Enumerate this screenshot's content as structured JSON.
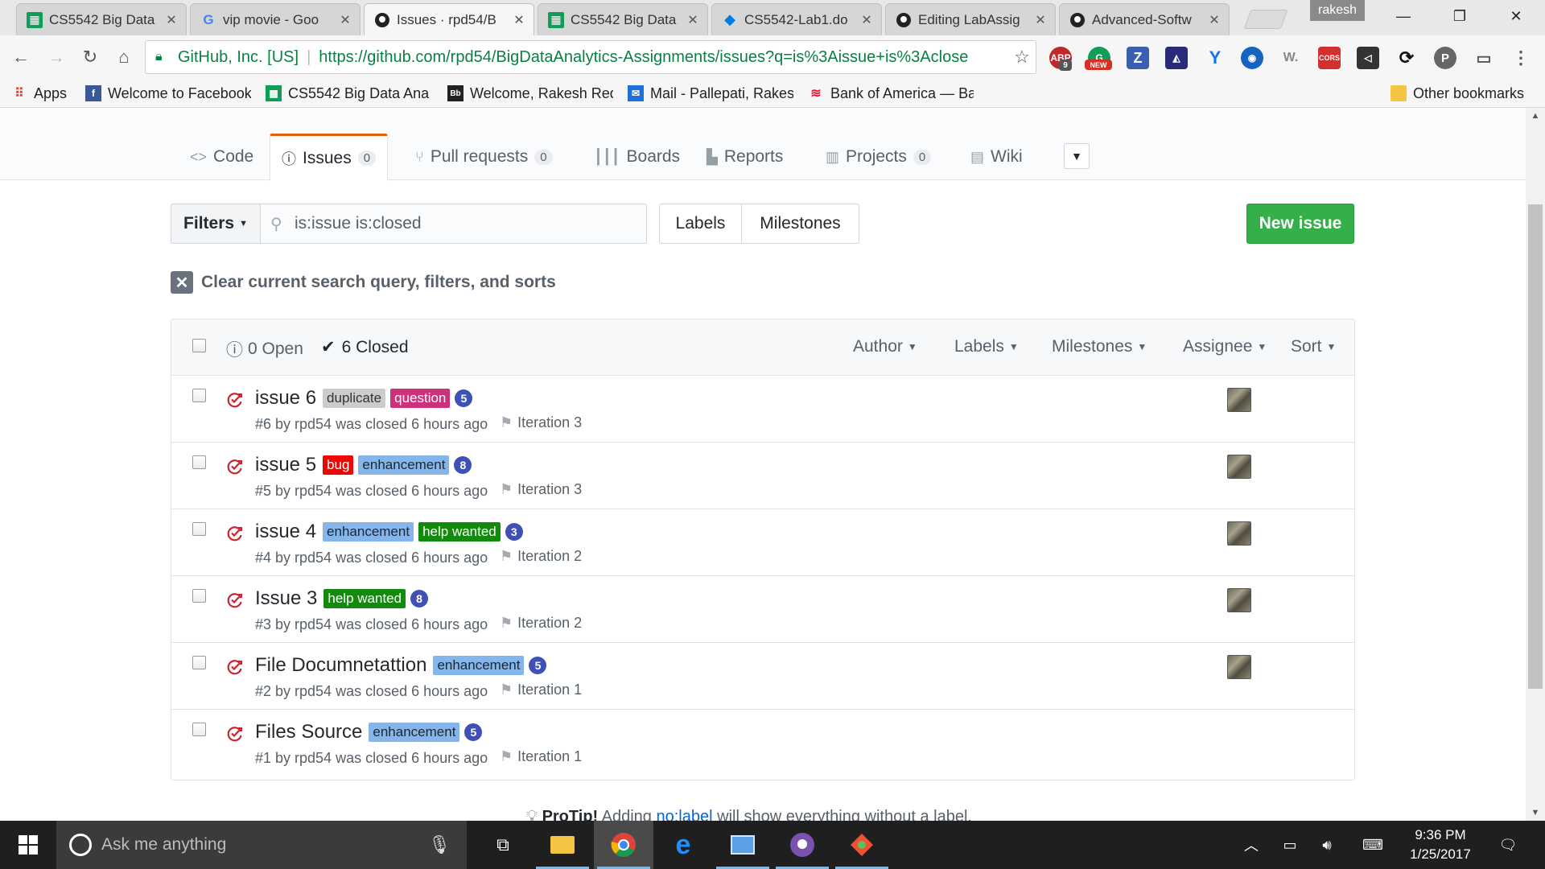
{
  "browser": {
    "tabs": [
      {
        "title": "CS5542 Big Data",
        "icon": "sheets-icon"
      },
      {
        "title": "vip movie - Goo",
        "icon": "google-icon"
      },
      {
        "title": "Issues · rpd54/B",
        "icon": "github-icon",
        "active": true
      },
      {
        "title": "CS5542 Big Data",
        "icon": "sheets-icon"
      },
      {
        "title": "CS5542-Lab1.do",
        "icon": "dropbox-icon"
      },
      {
        "title": "Editing LabAssig",
        "icon": "github-icon"
      },
      {
        "title": "Advanced-Softw",
        "icon": "github-icon"
      }
    ],
    "profile": "rakesh",
    "security_org": "GitHub, Inc. [US]",
    "url": "https://github.com/rpd54/BigDataAnalytics-Assignments/issues?q=is%3Aissue+is%3Aclose",
    "extension_badges": {
      "abp_count": "9",
      "new_badge": "NEW",
      "z": "Z",
      "w": "W.",
      "cors": "CORS",
      "p": "P"
    },
    "bookmarks": [
      "Apps",
      "Welcome to Facebook",
      "CS5542 Big Data Anal",
      "Welcome, Rakesh Red",
      "Mail - Pallepati, Rakes",
      "Bank of America — Ba"
    ],
    "other_bookmarks": "Other bookmarks"
  },
  "repo_nav": {
    "tabs": [
      {
        "label": "Code",
        "icon": "code-icon"
      },
      {
        "label": "Issues",
        "count": "0",
        "icon": "issue-opened-icon",
        "selected": true
      },
      {
        "label": "Pull requests",
        "count": "0",
        "icon": "git-pull-request-icon"
      },
      {
        "label": "Boards",
        "icon": "boards-icon"
      },
      {
        "label": "Reports",
        "icon": "reports-icon"
      },
      {
        "label": "Projects",
        "count": "0",
        "icon": "project-icon"
      },
      {
        "label": "Wiki",
        "icon": "book-icon"
      }
    ]
  },
  "toolbar": {
    "filters_label": "Filters",
    "search_value": "is:issue is:closed",
    "labels_button": "Labels",
    "milestones_button": "Milestones",
    "new_issue_button": "New issue",
    "clear_query": "Clear current search query, filters, and sorts"
  },
  "issues_header": {
    "open": "0 Open",
    "closed": "6 Closed",
    "filters": [
      "Author",
      "Labels",
      "Milestones",
      "Assignee",
      "Sort"
    ]
  },
  "issues": [
    {
      "title": "issue 6",
      "labels": [
        {
          "name": "duplicate",
          "bg": "#cccccc",
          "fg": "#333333"
        },
        {
          "name": "question",
          "bg": "#cc317c",
          "fg": "#ffffff"
        }
      ],
      "comments": "5",
      "meta": "#6 by rpd54 was closed 6 hours ago",
      "milestone": "Iteration 3",
      "assignee": true
    },
    {
      "title": "issue 5",
      "labels": [
        {
          "name": "bug",
          "bg": "#ee0701",
          "fg": "#ffffff"
        },
        {
          "name": "enhancement",
          "bg": "#84b6eb",
          "fg": "#1c2733"
        }
      ],
      "comments": "8",
      "meta": "#5 by rpd54 was closed 6 hours ago",
      "milestone": "Iteration 3",
      "assignee": true
    },
    {
      "title": "issue 4",
      "labels": [
        {
          "name": "enhancement",
          "bg": "#84b6eb",
          "fg": "#1c2733"
        },
        {
          "name": "help wanted",
          "bg": "#128a0c",
          "fg": "#ffffff"
        }
      ],
      "comments": "3",
      "meta": "#4 by rpd54 was closed 6 hours ago",
      "milestone": "Iteration 2",
      "assignee": true
    },
    {
      "title": "Issue 3",
      "labels": [
        {
          "name": "help wanted",
          "bg": "#128a0c",
          "fg": "#ffffff"
        }
      ],
      "comments": "8",
      "meta": "#3 by rpd54 was closed 6 hours ago",
      "milestone": "Iteration 2",
      "assignee": true
    },
    {
      "title": "File Documnetattion",
      "labels": [
        {
          "name": "enhancement",
          "bg": "#84b6eb",
          "fg": "#1c2733"
        }
      ],
      "comments": "5",
      "meta": "#2 by rpd54 was closed 6 hours ago",
      "milestone": "Iteration 1",
      "assignee": true
    },
    {
      "title": "Files Source",
      "labels": [
        {
          "name": "enhancement",
          "bg": "#84b6eb",
          "fg": "#1c2733"
        }
      ],
      "comments": "5",
      "meta": "#1 by rpd54 was closed 6 hours ago",
      "milestone": "Iteration 1",
      "assignee": false
    }
  ],
  "protip": {
    "lead": "ProTip!",
    "pre": "Adding",
    "link": "no:label",
    "post": "will show everything without a label."
  },
  "taskbar": {
    "search_placeholder": "Ask me anything",
    "time": "9:36 PM",
    "date": "1/25/2017"
  }
}
